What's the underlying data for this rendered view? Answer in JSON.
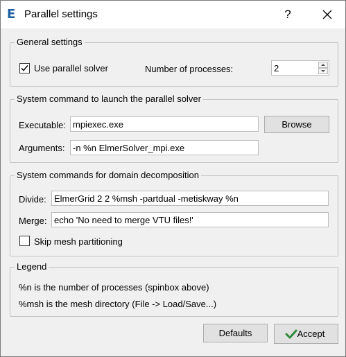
{
  "window": {
    "app_icon": "E",
    "title": "Parallel settings",
    "help_label": "?"
  },
  "general": {
    "title": "General settings",
    "use_parallel_label": "Use parallel solver",
    "use_parallel_checked": true,
    "num_processes_label": "Number of processes:",
    "num_processes_value": "2"
  },
  "launch": {
    "title": "System command to launch the parallel solver",
    "executable_label": "Executable:",
    "executable_value": "mpiexec.exe",
    "browse_label": "Browse",
    "arguments_label": "Arguments:",
    "arguments_value": "-n %n ElmerSolver_mpi.exe"
  },
  "decomposition": {
    "title": "System commands for domain decomposition",
    "divide_label": "Divide:",
    "divide_value": "ElmerGrid 2 2 %msh -partdual -metiskway %n",
    "merge_label": "Merge:",
    "merge_value": "echo 'No need to merge VTU files!'",
    "skip_label": "Skip mesh partitioning",
    "skip_checked": false
  },
  "legend": {
    "title": "Legend",
    "line1": "%n is the number of processes (spinbox above)",
    "line2": "%msh is the mesh directory (File -> Load/Save...)"
  },
  "buttons": {
    "defaults_label": "Defaults",
    "accept_label": "Accept"
  },
  "colors": {
    "app_icon": "#1f5ea0",
    "accept_check": "#2e8b3e"
  },
  "icons": {
    "close": "close-icon",
    "check": "checkmark-icon",
    "spin_up": "arrow-up-icon",
    "spin_down": "arrow-down-icon"
  }
}
